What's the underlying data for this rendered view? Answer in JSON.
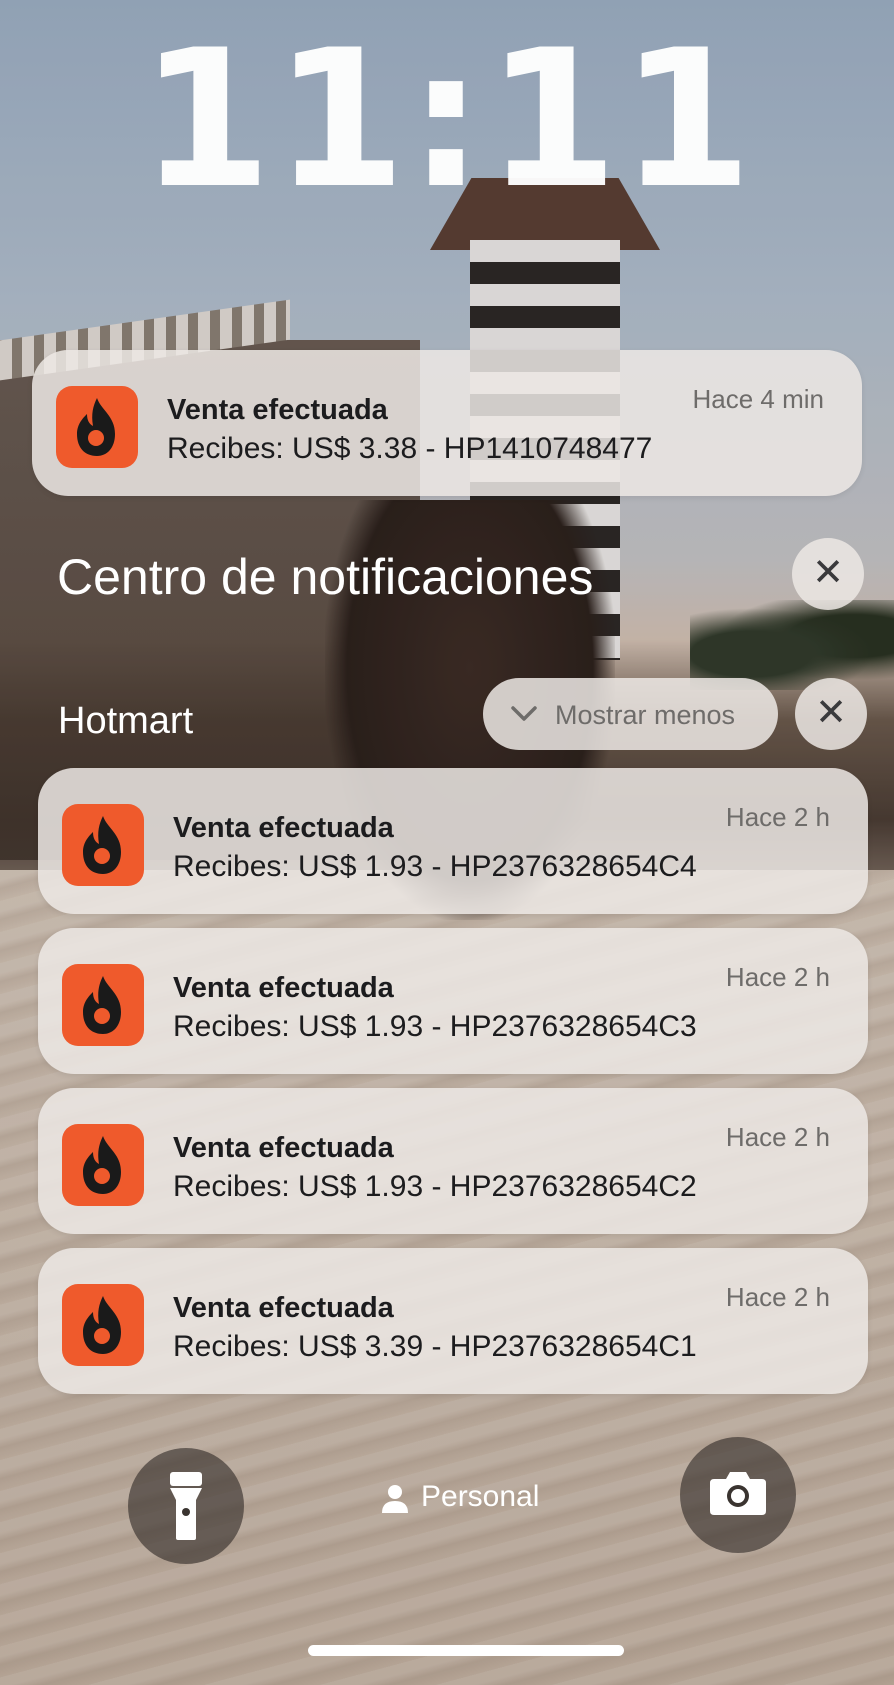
{
  "lockscreen": {
    "time": "11:11"
  },
  "pinned_notification": {
    "app_icon": "hotmart-flame-icon",
    "title": "Venta efectuada",
    "body": "Recibes: US$ 3.38 - HP1410748477",
    "time": "Hace 4 min"
  },
  "notification_center": {
    "title": "Centro de notificaciones",
    "close_icon": "close-icon"
  },
  "group": {
    "app_name": "Hotmart",
    "show_less_label": "Mostrar menos",
    "chevron_icon": "chevron-down-icon",
    "close_icon": "close-icon",
    "notifications": [
      {
        "title": "Venta efectuada",
        "body": "Recibes: US$ 1.93 - HP2376328654C4",
        "time": "Hace 2 h"
      },
      {
        "title": "Venta efectuada",
        "body": "Recibes: US$ 1.93 - HP2376328654C3",
        "time": "Hace 2 h"
      },
      {
        "title": "Venta efectuada",
        "body": "Recibes: US$ 1.93 - HP2376328654C2",
        "time": "Hace 2 h"
      },
      {
        "title": "Venta efectuada",
        "body": "Recibes: US$ 3.39 - HP2376328654C1",
        "time": "Hace 2 h"
      }
    ]
  },
  "bottom_bar": {
    "flashlight_icon": "flashlight-icon",
    "focus_icon": "person-icon",
    "focus_label": "Personal",
    "camera_icon": "camera-icon"
  },
  "colors": {
    "hotmart_orange": "#ef5a2c",
    "notification_bg": "#ece8e4"
  }
}
